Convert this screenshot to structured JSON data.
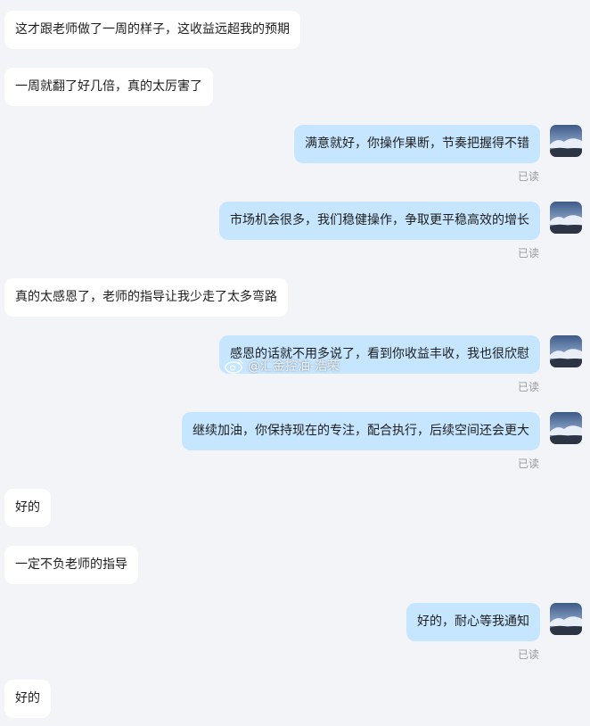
{
  "messages": [
    {
      "side": "left",
      "text": "这才跟老师做了一周的样子，这收益远超我的预期"
    },
    {
      "side": "left",
      "text": "一周就翻了好几倍，真的太厉害了"
    },
    {
      "side": "right",
      "text": "满意就好，你操作果断，节奏把握得不错",
      "read": "已读"
    },
    {
      "side": "right",
      "text": "市场机会很多，我们稳健操作，争取更平稳高效的增长",
      "read": "已读"
    },
    {
      "side": "left",
      "text": "真的太感恩了，老师的指导让我少走了太多弯路"
    },
    {
      "side": "right",
      "text": "感恩的话就不用多说了，看到你收益丰收，我也很欣慰",
      "read": "已读"
    },
    {
      "side": "right",
      "text": "继续加油，你保持现在的专注，配合执行，后续空间还会更大",
      "read": "已读"
    },
    {
      "side": "left",
      "text": "好的"
    },
    {
      "side": "left",
      "text": "一定不负老师的指导"
    },
    {
      "side": "right",
      "text": "好的，耐心等我通知",
      "read": "已读"
    },
    {
      "side": "left",
      "text": "好的"
    }
  ],
  "watermark": {
    "text": "@汇金控油-浩荣",
    "icon": "weibo-icon"
  },
  "avatar_icon": "sky-cloud-avatar"
}
